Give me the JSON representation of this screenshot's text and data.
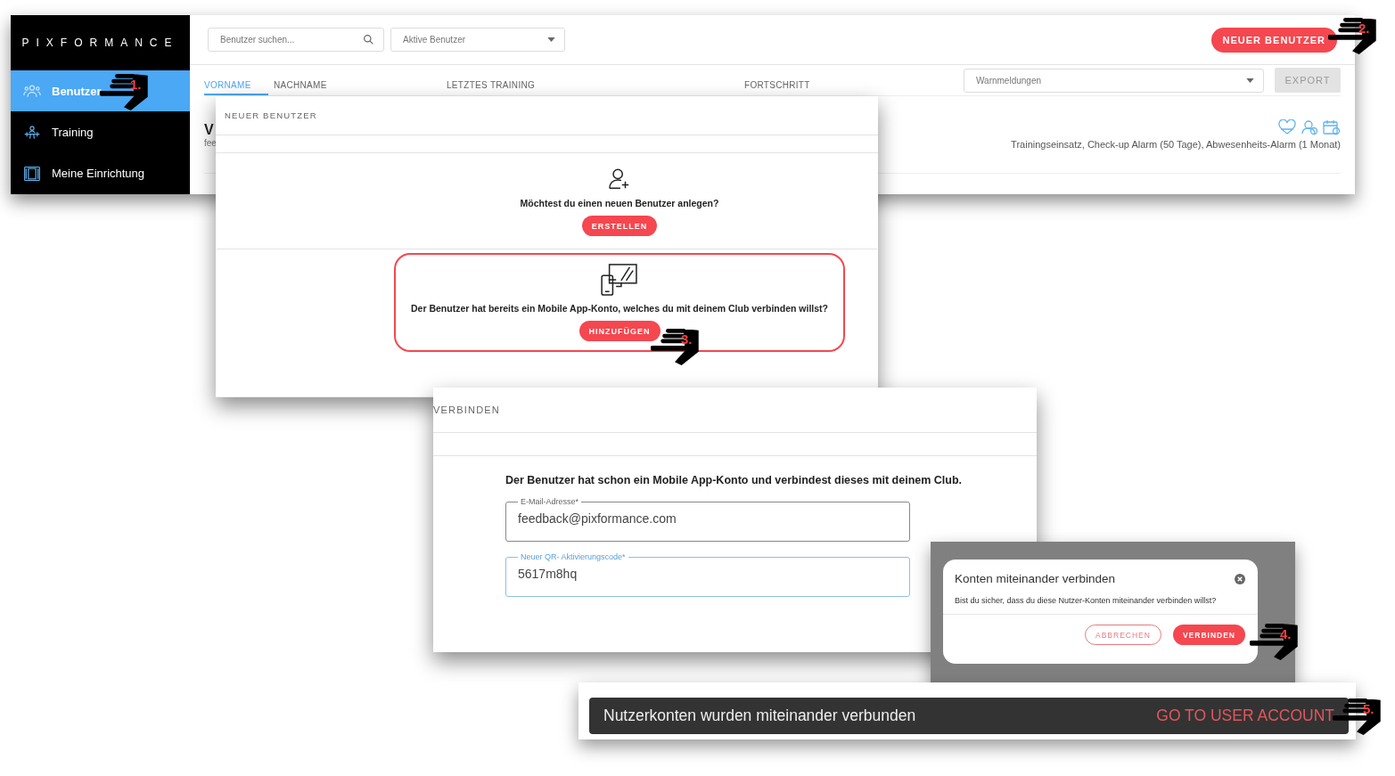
{
  "sidebar": {
    "logo": "PIXFORMANCE",
    "items": [
      {
        "label": "Benutzer",
        "selected": true,
        "kind": "users"
      },
      {
        "label": "Training",
        "selected": false,
        "kind": "training"
      },
      {
        "label": "Meine Einrichtung",
        "selected": false,
        "kind": "facility"
      }
    ]
  },
  "toolbar": {
    "search_placeholder": "Benutzer suchen...",
    "filter": "Aktive Benutzer",
    "new_user_button": "NEUER BENUTZER"
  },
  "table": {
    "columns": [
      {
        "label": "VORNAME",
        "selected": true
      },
      {
        "label": "NACHNAME",
        "selected": false
      },
      {
        "label": "LETZTES TRAINING",
        "selected": false
      },
      {
        "label": "FORTSCHRITT",
        "selected": false
      }
    ],
    "warnings_filter": "Warnmeldungen",
    "export_button": "EXPORT",
    "rows": [
      {
        "name": "V",
        "email": "fee",
        "alarms": "Trainingseinsatz, Check-up Alarm (50 Tage), Abwesenheits-Alarm (1 Monat)"
      }
    ]
  },
  "new_user_dialog": {
    "title": "NEUER BENUTZER",
    "options": [
      {
        "kind": "create",
        "question": "Möchtest du einen neuen Benutzer anlegen?",
        "button": "ERSTELLEN",
        "highlighted": false
      },
      {
        "kind": "link",
        "question": "Der Benutzer hat bereits ein Mobile App-Konto, welches du mit deinem Club verbinden willst?",
        "button": "HINZUFÜGEN",
        "highlighted": true
      }
    ]
  },
  "connect_dialog": {
    "title": "VERBINDEN",
    "intro": "Der Benutzer hat schon ein Mobile App-Konto und verbindest dieses mit deinem Club.",
    "fields": [
      {
        "label": "E-Mail-Adresse*",
        "value": "feedback@pixformance.com",
        "focused": false
      },
      {
        "label": "Neuer QR- Aktivierungscode*",
        "value": "5617m8hq",
        "focused": true
      }
    ]
  },
  "confirm_dialog": {
    "title": "Konten miteinander verbinden",
    "message": "Bist du sicher, dass du diese Nutzer-Konten miteinander verbinden willst?",
    "buttons": [
      {
        "label": "ABBRECHEN",
        "kind": "outline"
      },
      {
        "label": "VERBINDEN",
        "kind": "filled"
      }
    ]
  },
  "snackbar": {
    "message": "Nutzerkonten wurden miteinander verbunden",
    "action": "GO TO USER ACCOUNT"
  },
  "steps": [
    {
      "label": "1."
    },
    {
      "label": "2."
    },
    {
      "label": "3."
    },
    {
      "label": "4."
    },
    {
      "label": "5."
    }
  ]
}
